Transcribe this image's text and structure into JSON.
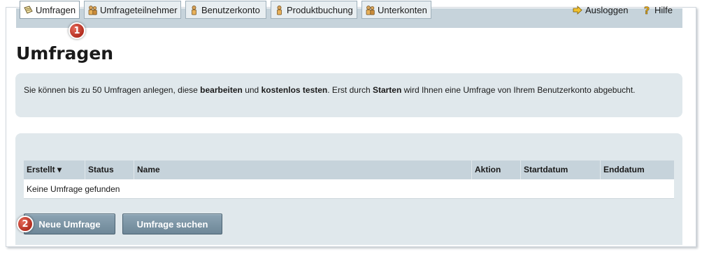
{
  "nav": {
    "items": [
      {
        "label": "Umfragen",
        "icon": "survey-icon",
        "active": true
      },
      {
        "label": "Umfrageteilnehmer",
        "icon": "participants-icon"
      },
      {
        "label": "Benutzerkonto",
        "icon": "user-account-icon"
      },
      {
        "label": "Produktbuchung",
        "icon": "product-booking-icon"
      },
      {
        "label": "Unterkonten",
        "icon": "subaccounts-icon"
      }
    ],
    "logout": {
      "label": "Ausloggen",
      "icon": "logout-arrow-icon"
    },
    "help": {
      "label": "Hilfe",
      "icon": "help-question-icon"
    }
  },
  "callouts": {
    "one": "1",
    "two": "2"
  },
  "page": {
    "title": "Umfragen"
  },
  "info": {
    "part1": "Sie können bis zu 50 Umfragen anlegen, diese ",
    "bold1": "bearbeiten",
    "part2": " und ",
    "bold2": "kostenlos testen",
    "part3": ". Erst durch ",
    "bold3": "Starten",
    "part4": " wird Ihnen eine Umfrage von Ihrem Benutzerkonto abgebucht."
  },
  "table": {
    "columns": [
      "Erstellt ▾",
      "Status",
      "Name",
      "Aktion",
      "Startdatum",
      "Enddatum"
    ],
    "empty_message": "Keine Umfrage gefunden"
  },
  "buttons": {
    "new_survey": "Neue Umfrage",
    "search_survey": "Umfrage suchen"
  },
  "colors": {
    "nav_bar": "#c6d3db",
    "panel": "#e0e8ec",
    "button": "#7d96a7",
    "badge": "#c0392b"
  }
}
